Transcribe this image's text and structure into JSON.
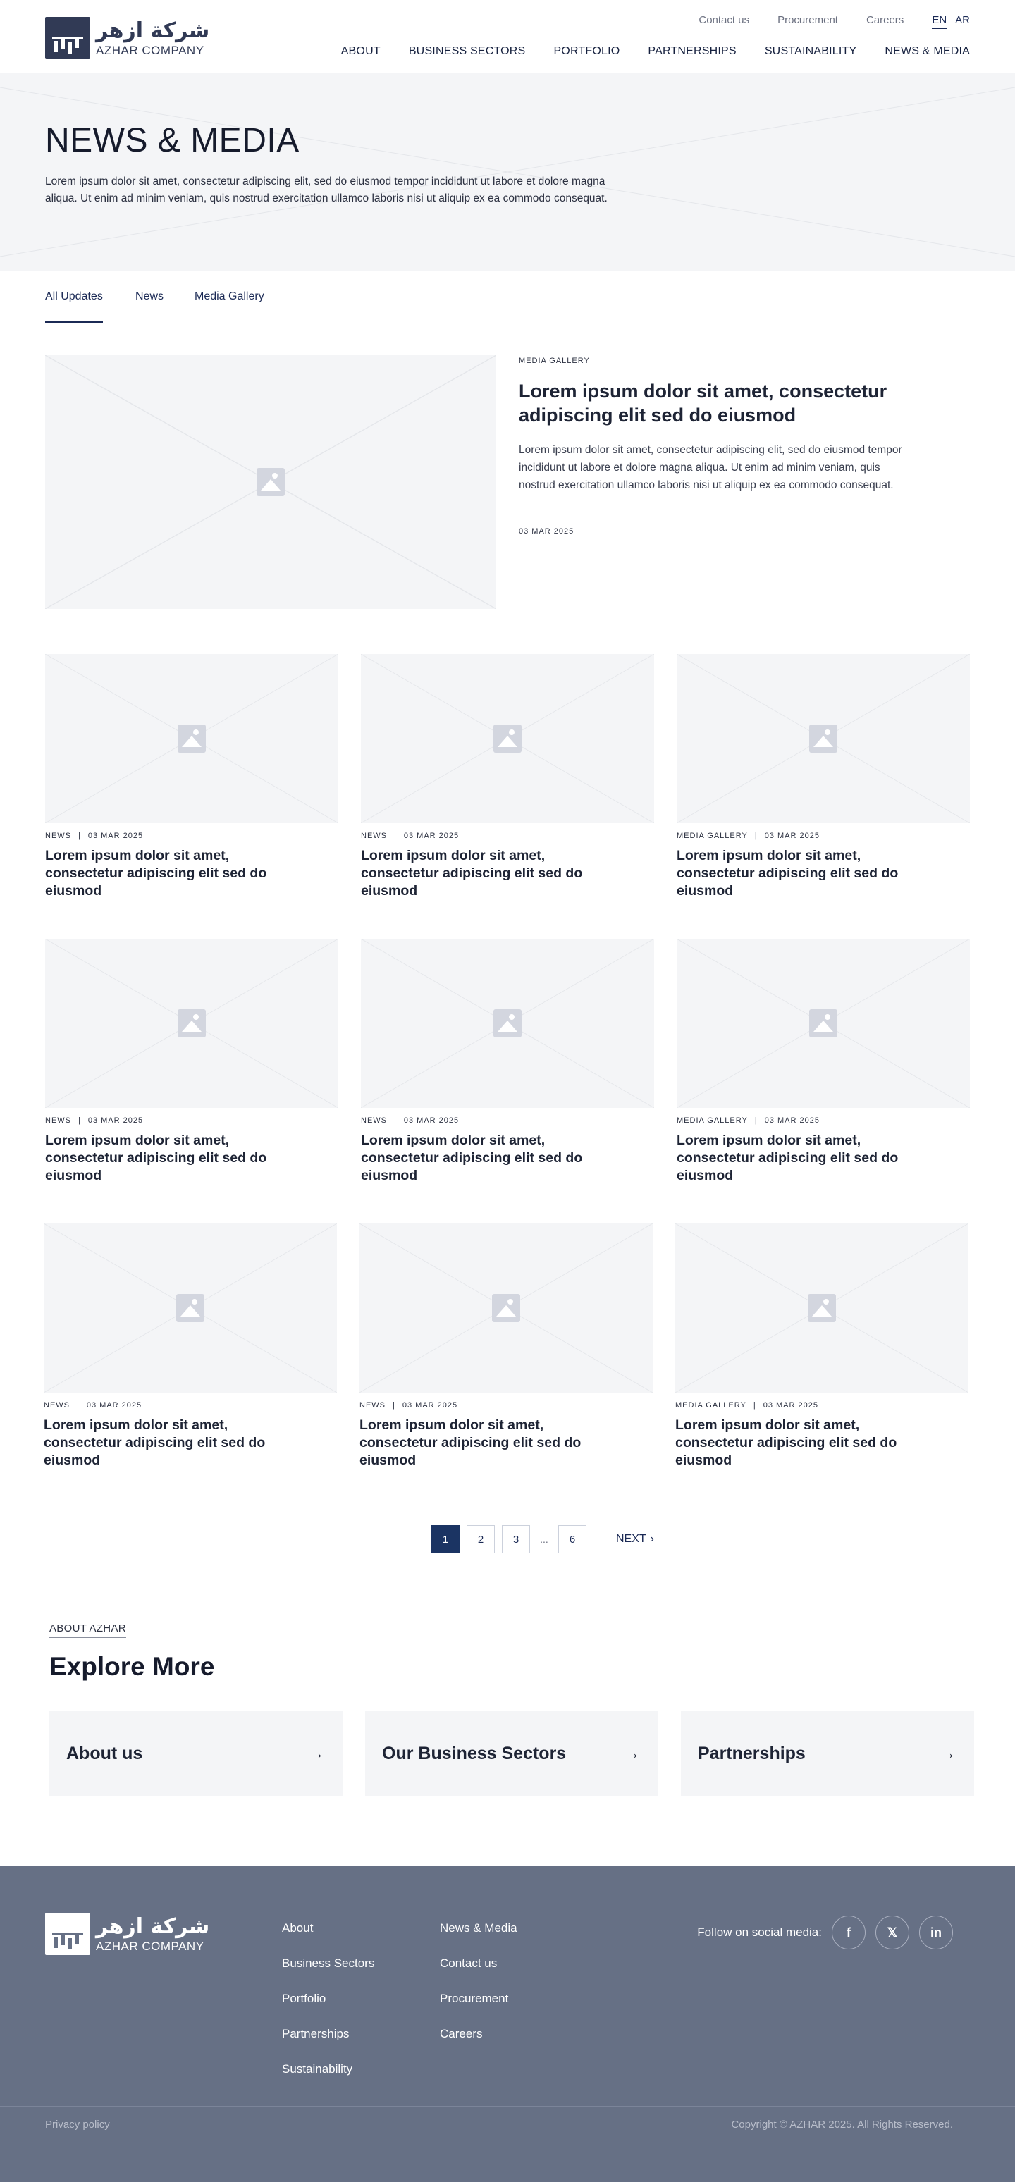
{
  "brand": {
    "arabic": "شركة ازهر",
    "english": "AZHAR COMPANY"
  },
  "utility_nav": [
    "Contact us",
    "Procurement",
    "Careers"
  ],
  "languages": [
    "EN",
    "AR"
  ],
  "main_nav": [
    "ABOUT",
    "BUSINESS SECTORS",
    "PORTFOLIO",
    "PARTNERSHIPS",
    "SUSTAINABILITY",
    "NEWS & MEDIA"
  ],
  "hero": {
    "title": "NEWS & MEDIA",
    "description": "Lorem ipsum dolor sit amet, consectetur adipiscing elit, sed do eiusmod tempor incididunt ut labore et dolore magna aliqua. Ut enim ad minim veniam, quis nostrud exercitation ullamco laboris nisi ut aliquip ex ea commodo consequat."
  },
  "tabs": [
    "All Updates",
    "News",
    "Media Gallery"
  ],
  "active_tab": "All Updates",
  "featured": {
    "category": "MEDIA GALLERY",
    "title": "Lorem ipsum dolor sit amet, consectetur adipiscing elit sed do eiusmod",
    "description": "Lorem ipsum dolor sit amet, consectetur adipiscing elit, sed do eiusmod tempor incididunt ut labore et dolore magna aliqua. Ut enim ad minim veniam, quis nostrud exercitation ullamco laboris nisi ut aliquip ex ea commodo consequat.",
    "date": "03 MAR 2025"
  },
  "cards": [
    {
      "category": "NEWS",
      "separator": "|",
      "date": "03 MAR 2025",
      "title": "Lorem ipsum dolor sit amet, consectetur adipiscing elit sed do eiusmod"
    },
    {
      "category": "NEWS",
      "separator": "|",
      "date": "03 MAR 2025",
      "title": "Lorem ipsum dolor sit amet, consectetur adipiscing elit sed do eiusmod"
    },
    {
      "category": "MEDIA GALLERY",
      "separator": "|",
      "date": "03 MAR 2025",
      "title": "Lorem ipsum dolor sit amet, consectetur adipiscing elit sed do eiusmod"
    },
    {
      "category": "NEWS",
      "separator": "|",
      "date": "03 MAR 2025",
      "title": "Lorem ipsum dolor sit amet, consectetur adipiscing elit sed do eiusmod"
    },
    {
      "category": "NEWS",
      "separator": "|",
      "date": "03 MAR 2025",
      "title": "Lorem ipsum dolor sit amet, consectetur adipiscing elit sed do eiusmod"
    },
    {
      "category": "MEDIA GALLERY",
      "separator": "|",
      "date": "03 MAR 2025",
      "title": "Lorem ipsum dolor sit amet, consectetur adipiscing elit sed do eiusmod"
    },
    {
      "category": "NEWS",
      "separator": "|",
      "date": "03 MAR 2025",
      "title": "Lorem ipsum dolor sit amet, consectetur adipiscing elit sed do eiusmod"
    },
    {
      "category": "NEWS",
      "separator": "|",
      "date": "03 MAR 2025",
      "title": "Lorem ipsum dolor sit amet, consectetur adipiscing elit sed do eiusmod"
    },
    {
      "category": "MEDIA GALLERY",
      "separator": "|",
      "date": "03 MAR 2025",
      "title": "Lorem ipsum dolor sit amet, consectetur adipiscing elit sed do eiusmod"
    }
  ],
  "pagination": {
    "pages": [
      "1",
      "2",
      "3",
      "6"
    ],
    "ellipsis": "...",
    "current": "1",
    "next_label": "NEXT",
    "next_icon": "chevron-right-icon"
  },
  "explore": {
    "eyebrow": "ABOUT AZHAR",
    "title": "Explore More",
    "cards": [
      "About us",
      "Our Business Sectors",
      "Partnerships"
    ],
    "arrow_icon": "arrow-right-icon"
  },
  "footer": {
    "col1": [
      "About",
      "Business Sectors",
      "Portfolio",
      "Partnerships",
      "Sustainability"
    ],
    "col2": [
      "News & Media",
      "Contact us",
      "Procurement",
      "Careers"
    ],
    "follow_label": "Follow on social media:",
    "social": [
      {
        "name": "facebook-icon",
        "glyph": "f"
      },
      {
        "name": "x-icon",
        "glyph": "𝕏"
      },
      {
        "name": "linkedin-icon",
        "glyph": "in"
      }
    ],
    "privacy": "Privacy policy",
    "copyright": "Copyright © AZHAR 2025. All Rights Reserved."
  },
  "colors": {
    "brand_navy": "#1b3463",
    "footer_bg": "#667085",
    "placeholder_bg": "#f4f5f7"
  }
}
